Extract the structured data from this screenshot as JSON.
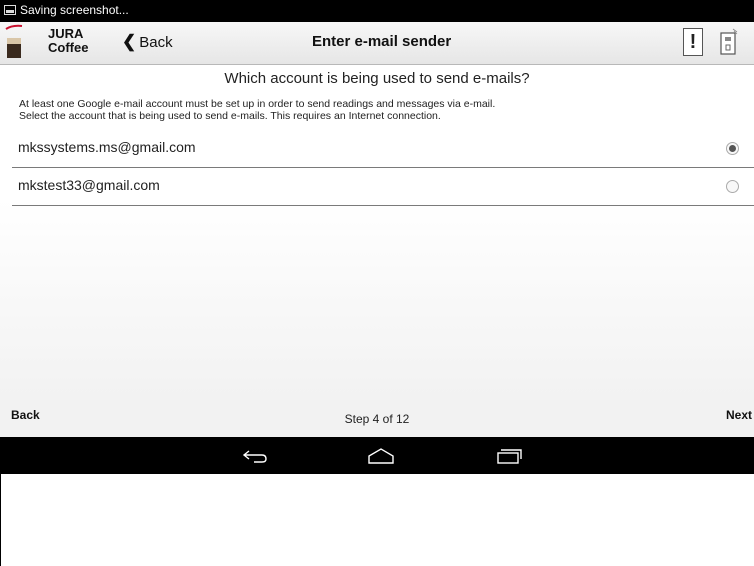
{
  "status_bar": {
    "notification": "Saving screenshot..."
  },
  "header": {
    "app_name": "JURA\nCoffee",
    "back_label": "Back",
    "title": "Enter e-mail sender",
    "alert_label": "!"
  },
  "content": {
    "question": "Which account is being used to send e-mails?",
    "info_line1": "At least one Google e-mail account must be set up in order to send readings and messages via e-mail.",
    "info_line2": "Select the account that is being used to send e-mails. This requires an Internet connection.",
    "accounts": [
      {
        "email": "mkssystems.ms@gmail.com",
        "selected": true
      },
      {
        "email": "mkstest33@gmail.com",
        "selected": false
      }
    ]
  },
  "footer": {
    "back_label": "Back",
    "step_text": "Step 4 of 12",
    "next_label": "Next"
  },
  "colors": {
    "statusbar": "#000000",
    "navbar": "#000000",
    "logo_red": "#c8102e"
  },
  "icons": [
    "screenshot-icon",
    "jura-logo-icon",
    "chevron-left-icon",
    "alert-icon",
    "coffee-machine-icon",
    "nav-back-icon",
    "nav-home-icon",
    "nav-recents-icon"
  ]
}
